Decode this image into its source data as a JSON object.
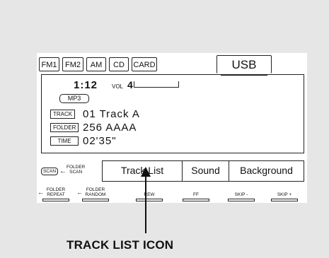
{
  "source_tabs": [
    "FM1",
    "FM2",
    "AM",
    "CD",
    "CARD",
    "USB"
  ],
  "active_tab": "USB",
  "display": {
    "elapsed": "1:12",
    "vol_label": "VOL",
    "vol_value": "4",
    "vol_level_fraction": 0.05,
    "format_badge": "MP3",
    "rows": [
      {
        "tag": "TRACK",
        "value": "01 Track A"
      },
      {
        "tag": "FOLDER",
        "value": "256 AAAA"
      },
      {
        "tag": "TIME",
        "value": "02'35\""
      }
    ]
  },
  "scan": {
    "button": "SCAN",
    "label_line1": "FOLDER",
    "label_line2": "SCAN"
  },
  "softkeys": [
    "Track List",
    "Sound",
    "Background"
  ],
  "hard_buttons": [
    {
      "line1": "FOLDER",
      "line2": "REPEAT"
    },
    {
      "line1": "FOLDER",
      "line2": "RANDOM"
    },
    {
      "line1": "",
      "line2": "REW"
    },
    {
      "line1": "",
      "line2": "FF"
    },
    {
      "line1": "",
      "line2": "SKIP -"
    },
    {
      "line1": "",
      "line2": "SKIP +"
    }
  ],
  "callout": "TRACK LIST ICON"
}
